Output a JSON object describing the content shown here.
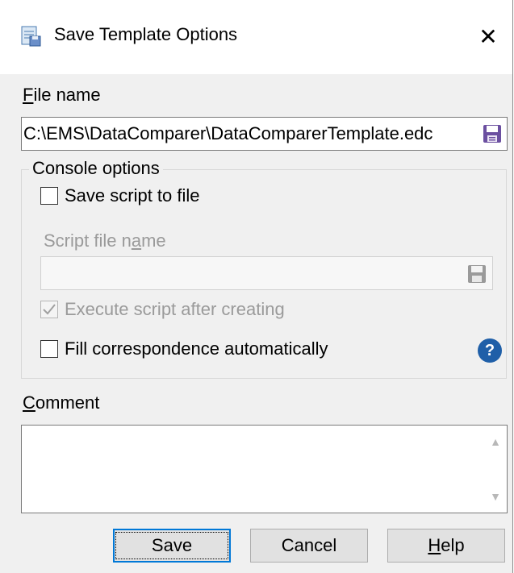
{
  "window": {
    "title": "Save Template Options",
    "close_glyph": "✕"
  },
  "file_name": {
    "label_accel": "F",
    "label_rest": "ile name",
    "value": "C:\\EMS\\DataComparer\\DataComparerTemplate.edc"
  },
  "console_options": {
    "legend": "Console options",
    "save_script": {
      "label": "Save script to file",
      "checked": false
    },
    "script_file_name": {
      "label_pre": "Script file n",
      "label_accel": "a",
      "label_post": "me",
      "value": ""
    },
    "execute_script": {
      "label": "Execute script after creating",
      "checked": true,
      "enabled": false
    },
    "fill_correspondence": {
      "label": "Fill correspondence automatically",
      "checked": false
    },
    "help_glyph": "?"
  },
  "comment": {
    "label_accel": "C",
    "label_rest": "omment",
    "value": ""
  },
  "buttons": {
    "save": "Save",
    "cancel": "Cancel",
    "help_accel": "H",
    "help_rest": "elp"
  },
  "icons": {
    "app": "template-save-icon",
    "save": "floppy-disk-icon",
    "help": "question-circle-icon"
  },
  "colors": {
    "accent": "#0078d7",
    "help_icon": "#1f5fa8",
    "floppy": "#6b4fa0"
  }
}
